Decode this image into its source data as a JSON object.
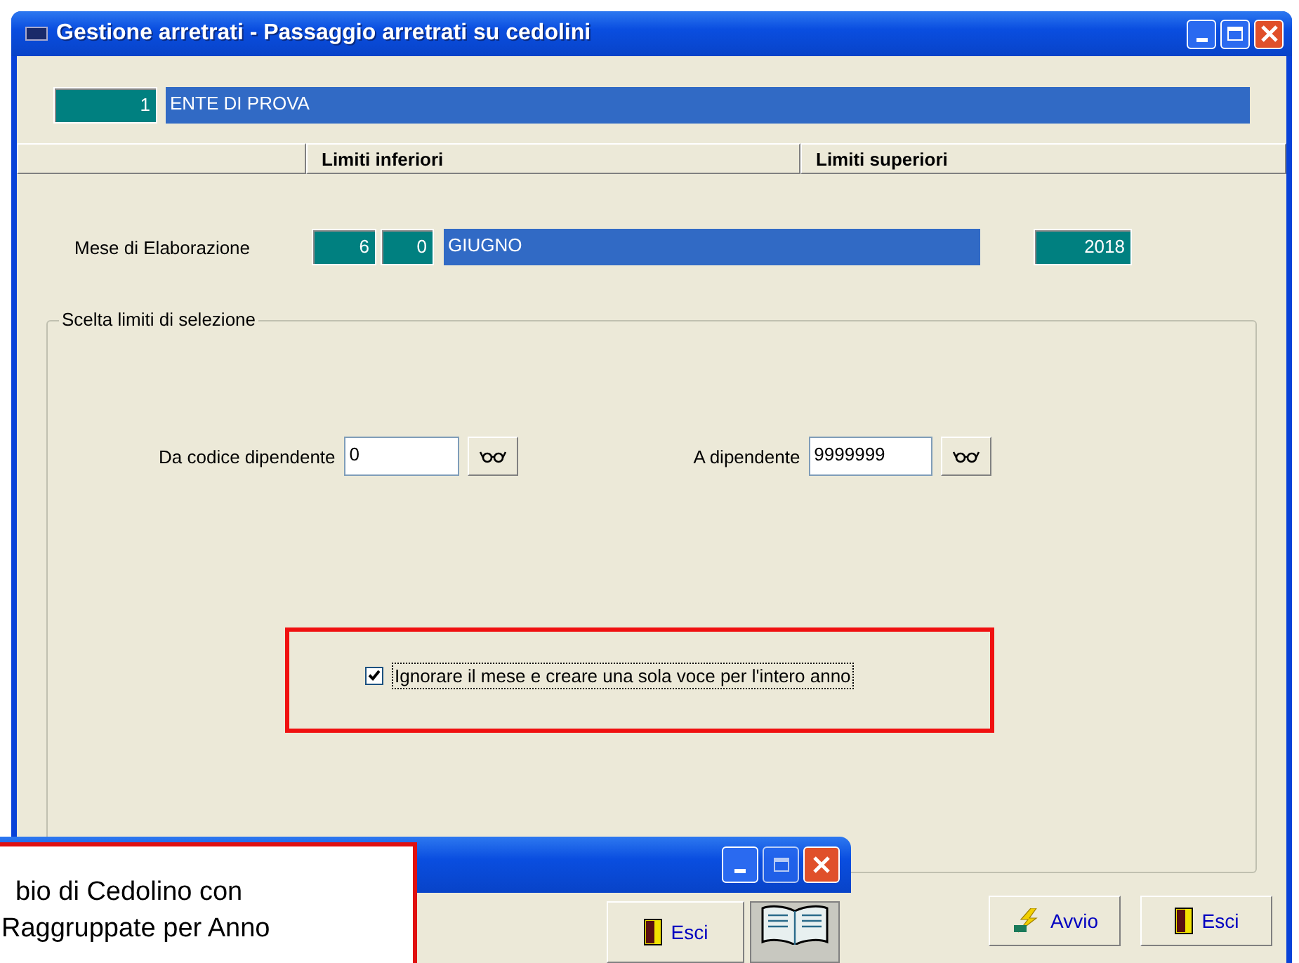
{
  "window": {
    "title": "Gestione arretrati - Passaggio arretrati su cedolini"
  },
  "ente": {
    "code": "1",
    "name": "ENTE DI PROVA"
  },
  "header_columns": [
    "",
    "Limiti inferiori",
    "Limiti superiori"
  ],
  "mese": {
    "label": "Mese di Elaborazione",
    "month": "6",
    "sub": "0",
    "name": "GIUGNO",
    "year": "2018"
  },
  "group": {
    "legend": "Scelta limiti di selezione",
    "fields": [
      {
        "label": "Da codice dipendente",
        "value": "0"
      },
      {
        "label": "A dipendente",
        "value": "9999999"
      }
    ],
    "option": {
      "label": "Ignorare il mese e creare una sola voce per l'intero anno",
      "checked": true
    }
  },
  "buttons": [
    {
      "label": "Avvio",
      "kind": "start"
    },
    {
      "label": "Esci",
      "kind": "exit"
    }
  ],
  "second_window": {
    "buttons": [
      {
        "label": "Esci",
        "kind": "exit"
      },
      {
        "kind": "book"
      }
    ]
  },
  "callout": {
    "lines": [
      "bio di Cedolino con",
      "Raggruppate per Anno"
    ]
  }
}
